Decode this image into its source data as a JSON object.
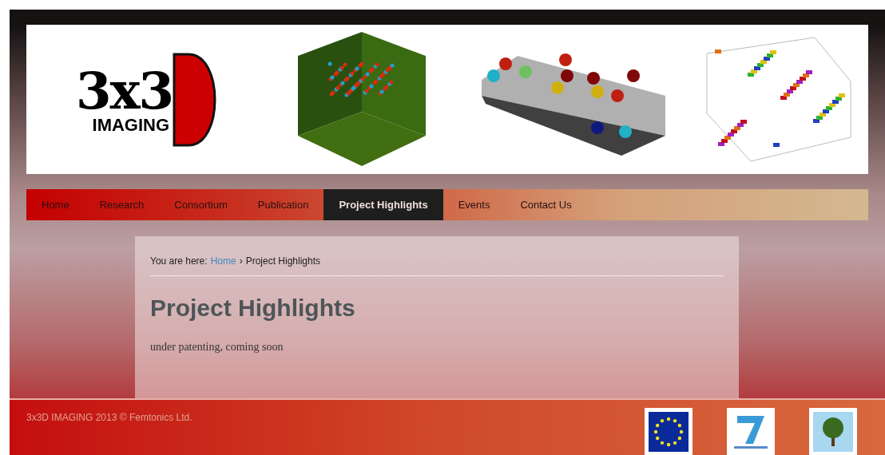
{
  "logo": {
    "mark": "3x3",
    "word": "IMAGING"
  },
  "nav": [
    {
      "label": "Home",
      "selected": false
    },
    {
      "label": "Research",
      "selected": false
    },
    {
      "label": "Consortium",
      "selected": false
    },
    {
      "label": "Publication",
      "selected": false
    },
    {
      "label": "Project Highlights",
      "selected": true
    },
    {
      "label": "Events",
      "selected": false
    },
    {
      "label": "Contact Us",
      "selected": false
    }
  ],
  "breadcrumb": {
    "prefix": "You are here:",
    "link": "Home",
    "separator": "›",
    "current": "Project Highlights"
  },
  "title": "Project Highlights",
  "body": "under patenting, coming soon",
  "footer": {
    "copyright": "3x3D IMAGING 2013 © Femtonics Ltd."
  }
}
